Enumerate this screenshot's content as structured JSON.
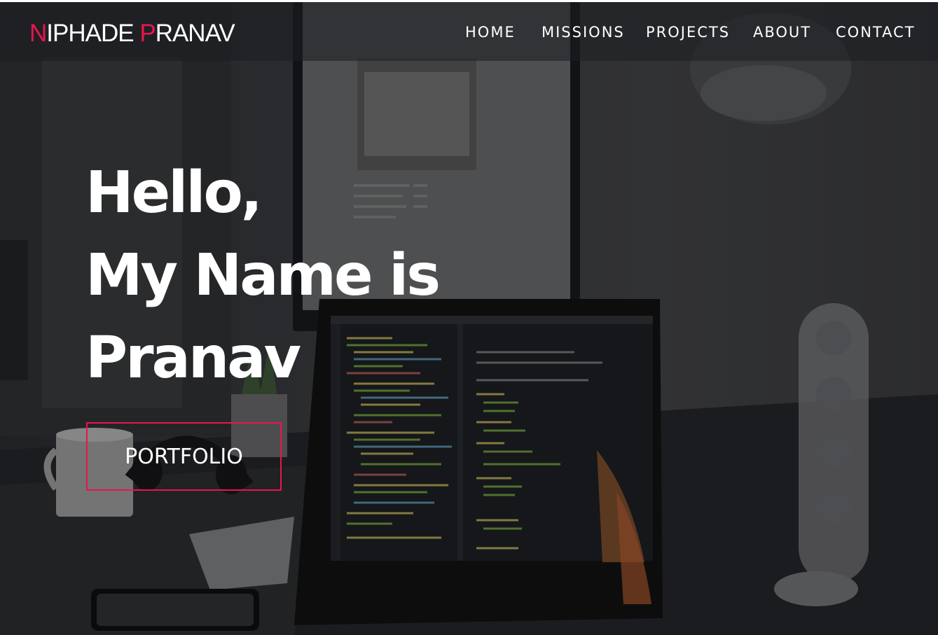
{
  "brand": {
    "first_initial": "N",
    "first_rest": "IPHADE ",
    "last_initial": "P",
    "last_rest": "RANAV",
    "accent_color": "#e8164c"
  },
  "nav": {
    "items": [
      {
        "label": "HOME"
      },
      {
        "label": "MISSIONS"
      },
      {
        "label": "PROJECTS"
      },
      {
        "label": "ABOUT"
      },
      {
        "label": "CONTACT"
      }
    ]
  },
  "hero": {
    "lines": [
      "Hello,",
      "My Name is",
      "Pranav"
    ],
    "button_label": "PORTFOLIO"
  }
}
